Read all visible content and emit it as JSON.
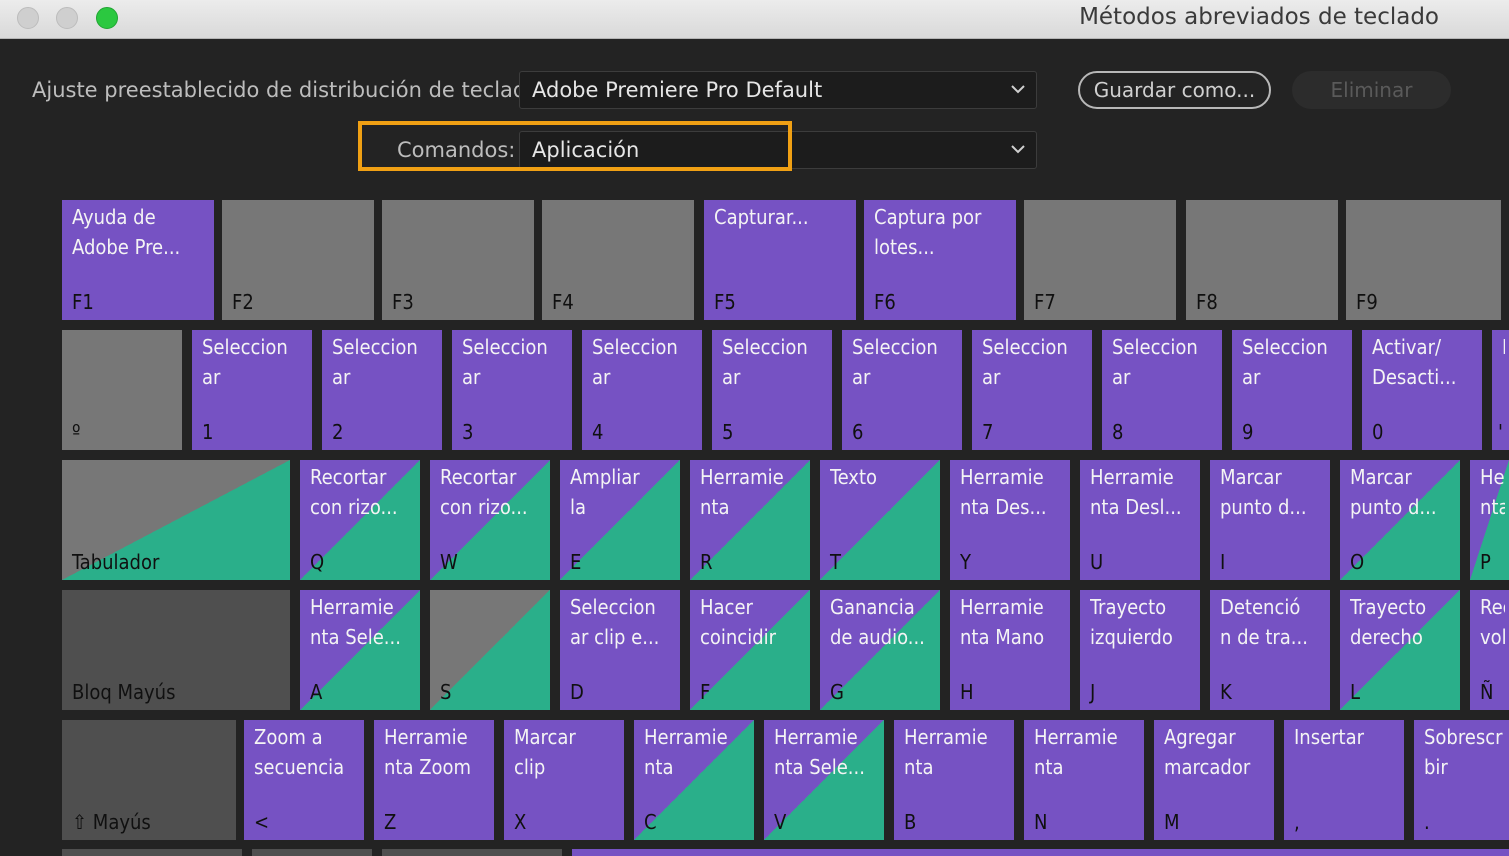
{
  "window": {
    "title": "Métodos abreviados de teclado"
  },
  "preset": {
    "label": "Ajuste preestablecido de distribución de teclado:",
    "value": "Adobe Premiere Pro Default",
    "save_as": "Guardar como...",
    "delete": "Eliminar"
  },
  "commands": {
    "label": "Comandos:",
    "value": "Aplicación"
  },
  "colors": {
    "app_command": "#7652c3",
    "panel_command": "#2aaf8a",
    "unassigned": "#777777",
    "highlight": "#f0a014"
  },
  "rows": {
    "function": [
      {
        "key": "F1",
        "cmd": "Ayuda de\nAdobe Pre..."
      },
      {
        "key": "F2",
        "cmd": ""
      },
      {
        "key": "F3",
        "cmd": ""
      },
      {
        "key": "F4",
        "cmd": ""
      },
      {
        "key": "F5",
        "cmd": "Capturar..."
      },
      {
        "key": "F6",
        "cmd": "Captura por\nlotes..."
      },
      {
        "key": "F7",
        "cmd": ""
      },
      {
        "key": "F8",
        "cmd": ""
      },
      {
        "key": "F9",
        "cmd": ""
      }
    ],
    "number": [
      {
        "key": "º",
        "cmd": ""
      },
      {
        "key": "1",
        "cmd": "Seleccion\nar"
      },
      {
        "key": "2",
        "cmd": "Seleccion\nar"
      },
      {
        "key": "3",
        "cmd": "Seleccion\nar"
      },
      {
        "key": "4",
        "cmd": "Seleccion\nar"
      },
      {
        "key": "5",
        "cmd": "Seleccion\nar"
      },
      {
        "key": "6",
        "cmd": "Seleccion\nar"
      },
      {
        "key": "7",
        "cmd": "Seleccion\nar"
      },
      {
        "key": "8",
        "cmd": "Seleccion\nar"
      },
      {
        "key": "9",
        "cmd": "Seleccion\nar"
      },
      {
        "key": "0",
        "cmd": "Activar/\nDesacti..."
      },
      {
        "key": "'",
        "cmd": "E"
      }
    ],
    "qwerty": [
      {
        "key": "Tabulador",
        "cmd": ""
      },
      {
        "key": "Q",
        "cmd": "Recortar\ncon rizo..."
      },
      {
        "key": "W",
        "cmd": "Recortar\ncon rizo..."
      },
      {
        "key": "E",
        "cmd": "Ampliar\nla"
      },
      {
        "key": "R",
        "cmd": "Herramie\nnta"
      },
      {
        "key": "T",
        "cmd": "Texto"
      },
      {
        "key": "Y",
        "cmd": "Herramie\nnta Des..."
      },
      {
        "key": "U",
        "cmd": "Herramie\nnta Desl..."
      },
      {
        "key": "I",
        "cmd": "Marcar\npunto d..."
      },
      {
        "key": "O",
        "cmd": "Marcar\npunto d..."
      },
      {
        "key": "P",
        "cmd": "Her\nnta"
      }
    ],
    "asdf": [
      {
        "key": "Bloq Mayús",
        "cmd": ""
      },
      {
        "key": "A",
        "cmd": "Herramie\nnta Sele..."
      },
      {
        "key": "S",
        "cmd": ""
      },
      {
        "key": "D",
        "cmd": "Seleccion\nar clip e..."
      },
      {
        "key": "F",
        "cmd": "Hacer\ncoincidir"
      },
      {
        "key": "G",
        "cmd": "Ganancia\nde audio..."
      },
      {
        "key": "H",
        "cmd": "Herramie\nnta Mano"
      },
      {
        "key": "J",
        "cmd": "Trayecto\nizquierdo"
      },
      {
        "key": "K",
        "cmd": "Detenció\nn de tra..."
      },
      {
        "key": "L",
        "cmd": "Trayecto\nderecho"
      },
      {
        "key": "Ñ",
        "cmd": "Rec\nvol"
      }
    ],
    "zxcv": [
      {
        "key": "⇧ Mayús",
        "cmd": ""
      },
      {
        "key": "<",
        "cmd": "Zoom a\nsecuencia"
      },
      {
        "key": "Z",
        "cmd": "Herramie\nnta Zoom"
      },
      {
        "key": "X",
        "cmd": "Marcar\nclip"
      },
      {
        "key": "C",
        "cmd": "Herramie\nnta"
      },
      {
        "key": "V",
        "cmd": "Herramie\nnta Sele..."
      },
      {
        "key": "B",
        "cmd": "Herramie\nnta"
      },
      {
        "key": "N",
        "cmd": "Herramie\nnta"
      },
      {
        "key": "M",
        "cmd": "Agregar\nmarcador"
      },
      {
        "key": ",",
        "cmd": "Insertar"
      },
      {
        "key": ".",
        "cmd": "Sobrescr\nbir"
      }
    ]
  }
}
